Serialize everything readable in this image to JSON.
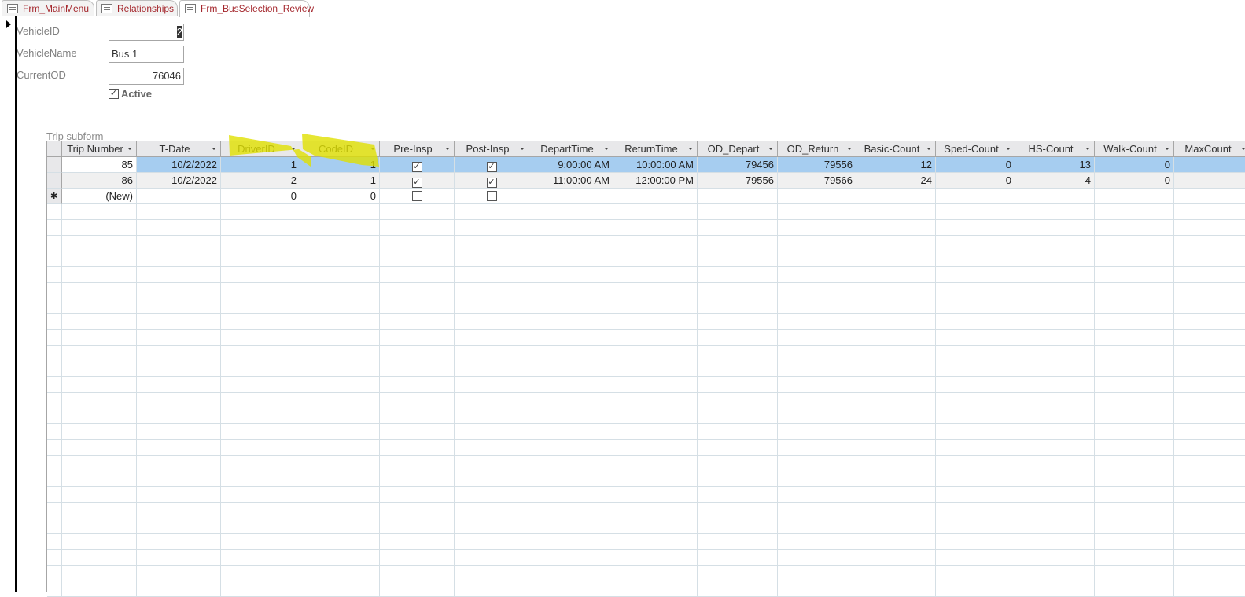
{
  "tabs": [
    {
      "label": "Frm_MainMenu",
      "icon": "form-icon"
    },
    {
      "label": "Relationships",
      "icon": "relationships-icon"
    },
    {
      "label": "Frm_BusSelection_Review",
      "icon": "form-icon",
      "active": true
    }
  ],
  "form": {
    "vehicle_id_label": "VehicleID",
    "vehicle_id": "2",
    "vehicle_name_label": "VehicleName",
    "vehicle_name": "Bus 1",
    "current_od_label": "CurrentOD",
    "current_od": "76046",
    "active_label": "Active",
    "active": true
  },
  "subform": {
    "label": "Trip subform",
    "columns": [
      "Trip Number",
      "T-Date",
      "DriverID",
      "CodeID",
      "Pre-Insp",
      "Post-Insp",
      "DepartTime",
      "ReturnTime",
      "OD_Depart",
      "OD_Return",
      "Basic-Count",
      "Sped-Count",
      "HS-Count",
      "Walk-Count",
      "MaxCount"
    ],
    "rows": [
      [
        "85",
        "10/2/2022",
        "1",
        "1",
        true,
        true,
        "9:00:00 AM",
        "10:00:00 AM",
        "79456",
        "79556",
        "12",
        "0",
        "13",
        "0",
        ""
      ],
      [
        "86",
        "10/2/2022",
        "2",
        "1",
        true,
        true,
        "11:00:00 AM",
        "12:00:00 PM",
        "79556",
        "79566",
        "24",
        "0",
        "4",
        "0",
        ""
      ],
      [
        "(New)",
        "",
        "0",
        "0",
        false,
        false,
        "",
        "",
        "",
        "",
        "",
        "",
        "",
        "",
        ""
      ]
    ],
    "highlight_color": "#e0e000"
  }
}
